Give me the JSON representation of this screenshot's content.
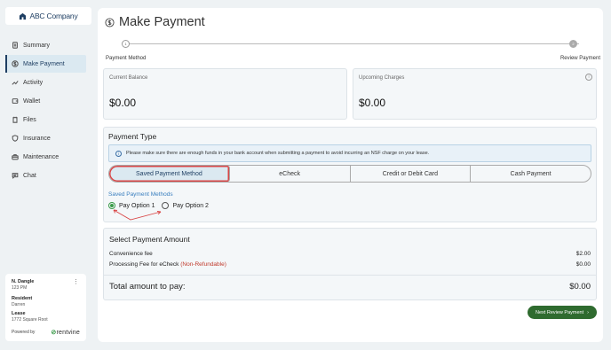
{
  "app": {
    "logo_text": "ABC Company"
  },
  "sidebar": {
    "items": [
      {
        "label": "Summary",
        "icon": "document-icon"
      },
      {
        "label": "Make Payment",
        "icon": "dollar-icon",
        "active": true
      },
      {
        "label": "Activity",
        "icon": "trend-icon"
      },
      {
        "label": "Wallet",
        "icon": "wallet-icon"
      },
      {
        "label": "Files",
        "icon": "folder-icon"
      },
      {
        "label": "Insurance",
        "icon": "shield-icon"
      },
      {
        "label": "Maintenance",
        "icon": "toolbox-icon"
      },
      {
        "label": "Chat",
        "icon": "chat-icon"
      }
    ]
  },
  "user_card": {
    "name": "N. Dangle",
    "time": "123 PM",
    "resident_label": "Resident",
    "resident_value": "Darren",
    "lease_label": "Lease",
    "lease_value": "1772 Square Root",
    "powered_by": "Powered by",
    "brand_prefix": "",
    "brand": "rentvine"
  },
  "page": {
    "title": "Make Payment",
    "steps": [
      {
        "number": "1",
        "label": "Payment Method"
      },
      {
        "number": "2",
        "label": "Review Payment"
      }
    ]
  },
  "balances": {
    "current_label": "Current Balance",
    "current_value": "$0.00",
    "upcoming_label": "Upcoming Charges",
    "upcoming_value": "$0.00"
  },
  "payment_type": {
    "title": "Payment Type",
    "notice": "Please make sure there are enough funds in your bank account when submitting a payment to avoid incurring an NSF charge on your lease.",
    "tabs": [
      "Saved Payment Method",
      "eCheck",
      "Credit or Debit Card",
      "Cash Payment"
    ],
    "selected_tab": "Saved Payment Method",
    "saved_label": "Saved Payment Methods",
    "options": [
      "Pay Option 1",
      "Pay Option 2"
    ],
    "selected_option": "Pay Option 1"
  },
  "amount": {
    "title": "Select Payment Amount",
    "convenience_label": "Convenience fee",
    "convenience_value": "$2.00",
    "processing_label": "Processing Fee for eCheck",
    "processing_note": "(Non-Refundable)",
    "processing_value": "$0.00",
    "total_label": "Total amount to pay:",
    "total_value": "$0.00"
  },
  "actions": {
    "next_label": "Next Review Payment"
  },
  "colors": {
    "accent": "#1f3f63",
    "button": "#2f6b2f",
    "highlight": "#d94545",
    "link": "#3a7fbf"
  }
}
